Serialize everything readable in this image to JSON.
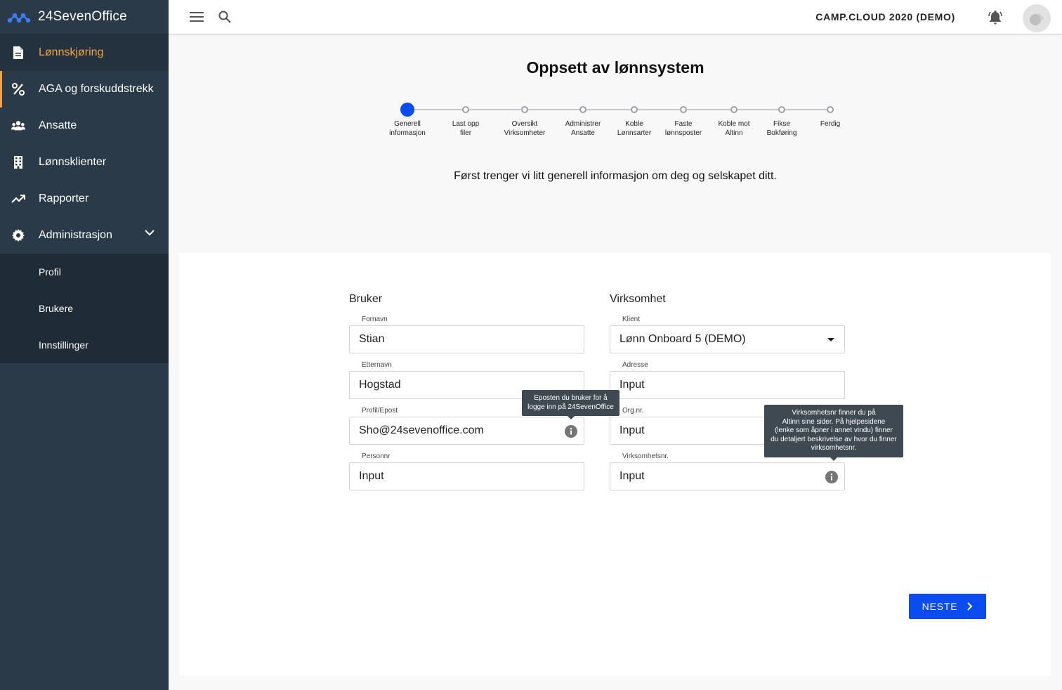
{
  "brand": {
    "name": "24SevenOffice",
    "accent": "#f4a340",
    "primary": "#0a4cf0"
  },
  "sidebar": {
    "items": [
      {
        "label": "Lønnskjøring",
        "icon": "document-icon"
      },
      {
        "label": "AGA og forskuddstrekk",
        "icon": "percent-icon"
      },
      {
        "label": "Ansatte",
        "icon": "users-icon"
      },
      {
        "label": "Lønnsklienter",
        "icon": "building-icon"
      },
      {
        "label": "Rapporter",
        "icon": "trending-icon"
      },
      {
        "label": "Administrasjon",
        "icon": "gear-icon"
      }
    ],
    "subitems": [
      {
        "label": "Profil"
      },
      {
        "label": "Brukere"
      },
      {
        "label": "Innstillinger"
      }
    ]
  },
  "topbar": {
    "company": "CAMP.CLOUD 2020 (DEMO)"
  },
  "page": {
    "title": "Oppsett av lønnsystem",
    "intro": "Først trenger vi litt generell informasjon om deg og selskapet ditt."
  },
  "steps": [
    {
      "l1": "Generell",
      "l2": "informasjon"
    },
    {
      "l1": "Last opp",
      "l2": "filer"
    },
    {
      "l1": "Oversikt",
      "l2": "Virksomheter"
    },
    {
      "l1": "Administrer",
      "l2": "Ansatte"
    },
    {
      "l1": "Koble",
      "l2": "Lønnsarter"
    },
    {
      "l1": "Faste",
      "l2": "lønnsposter"
    },
    {
      "l1": "Koble mot",
      "l2": "Altinn"
    },
    {
      "l1": "Fikse",
      "l2": "Bokføring"
    },
    {
      "l1": "Ferdig",
      "l2": ""
    }
  ],
  "bruker": {
    "title": "Bruker",
    "fornavn": {
      "label": "Fornavn",
      "value": "Stian"
    },
    "etternavn": {
      "label": "Etternavn",
      "value": "Hogstad"
    },
    "epost": {
      "label": "Profil/Epost",
      "value": "Sho@24sevenoffice.com"
    },
    "personnr": {
      "label": "Personnr",
      "value": "Input"
    },
    "epost_tooltip": {
      "l1": "Eposten du bruker for å",
      "l2": "logge inn på 24SevenOffice"
    }
  },
  "virksomhet": {
    "title": "Virksomhet",
    "klient": {
      "label": "Klient",
      "value": "Lønn Onboard 5 (DEMO)"
    },
    "adresse": {
      "label": "Adresse",
      "value": "Input"
    },
    "orgnr": {
      "label": "Org.nr.",
      "value": "Input"
    },
    "virksomhetsnr": {
      "label": "Virksomhetsnr.",
      "value": "Input"
    },
    "tooltip": {
      "l1": "Virksomhetsnr finner du på",
      "l2": "Altinn sine sider. På hjelpesidene",
      "l3": "(lenke som åpner i annet vindu) finner",
      "l4": "du detaljert beskrivelse av hvor du finner",
      "l5": "virksomhetsnr."
    }
  },
  "actions": {
    "next": "NESTE"
  }
}
